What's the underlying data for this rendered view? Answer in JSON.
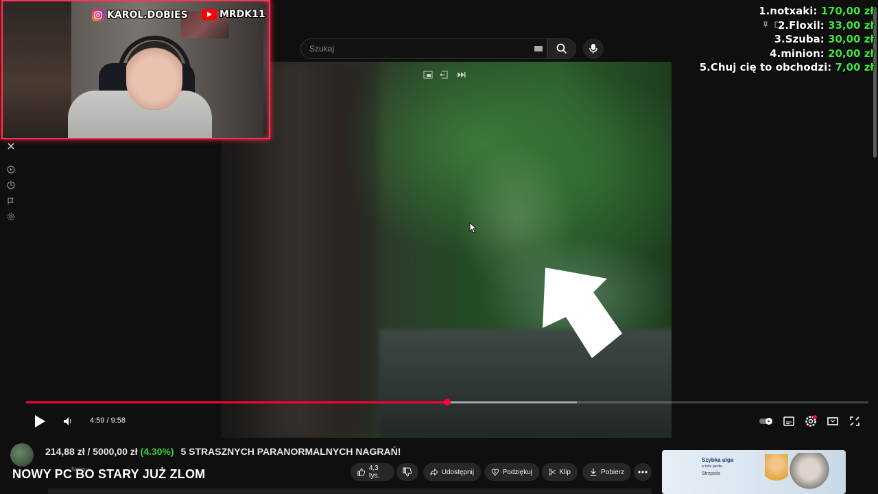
{
  "search": {
    "placeholder": "Szukaj"
  },
  "webcam": {
    "instagram": "KAROL.DOBIES",
    "youtube": "MRDK11"
  },
  "leaderboard": [
    {
      "rank_name": "1.notxaki:",
      "amount": "170,00 zł"
    },
    {
      "rank_name": "2.Floxil:",
      "amount": "33,00 zł"
    },
    {
      "rank_name": "3.Szuba:",
      "amount": "30,00 zł"
    },
    {
      "rank_name": "4.minion:",
      "amount": "20,00 zł"
    },
    {
      "rank_name": "5.Chuj cię to obchodzi:",
      "amount": "7,00 zł"
    }
  ],
  "player": {
    "time": "4:59 / 9:58",
    "played_fraction": 0.4,
    "buffered_fraction": 0.654
  },
  "video_title": "5 STRASZNYCH PARANORMALNYCH NAGRAŃ!",
  "donation_goal": {
    "text": "214,88 zł / 5000,00 zł",
    "percent": "(4.30%)"
  },
  "goal_caption": "NOWY PC BO STARY JUŻ ZLOM",
  "channel": {
    "name": "Neksu",
    "subscribers": ""
  },
  "actions": {
    "like_count": "4,3 tys.",
    "share": "Udostępnij",
    "thanks": "Podziękuj",
    "clip": "Klip",
    "download": "Pobierz"
  },
  "ad": {
    "title": "Szybka ulga",
    "subtitle": "w bólu gardła",
    "brand": "Strepsils"
  },
  "colors": {
    "accent": "#ff0033",
    "webcam_border": "#ff3355",
    "donation_green": "#3ee83e"
  }
}
